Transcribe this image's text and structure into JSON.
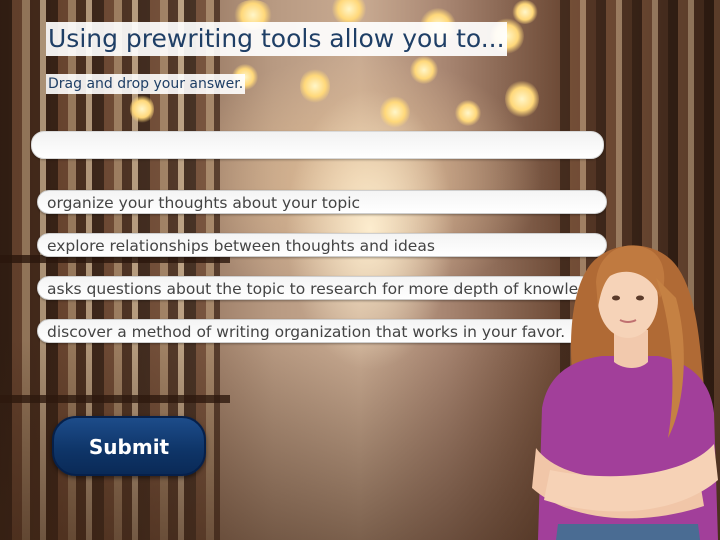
{
  "question": {
    "title": "Using prewriting tools allow you to...",
    "instruction": "Drag and drop your answer."
  },
  "drop_target": {
    "value": ""
  },
  "options": [
    "organize your thoughts about your topic",
    "explore relationships between thoughts and ideas",
    "asks questions about the topic to research for more depth of knowledge.",
    "discover a method of writing organization that works in your favor."
  ],
  "submit_label": "Submit",
  "colors": {
    "title_text": "#1f3f66",
    "submit_button": "#0e3467",
    "shirt": "#a23f9a",
    "hair": "#b8703a"
  }
}
